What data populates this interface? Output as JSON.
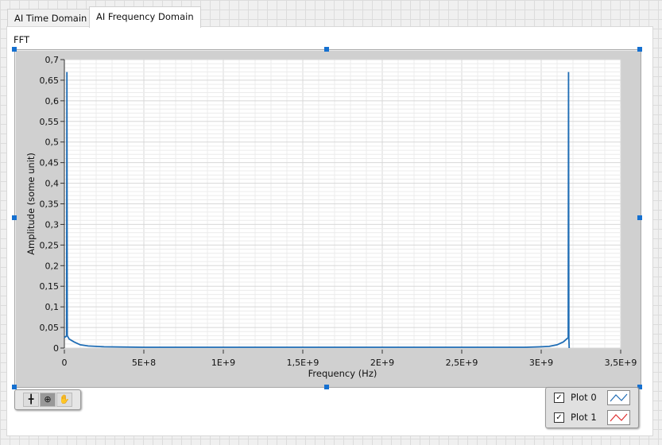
{
  "tabs": [
    {
      "label": "AI Time Domain"
    },
    {
      "label": "AI Frequency Domain"
    }
  ],
  "graph": {
    "label": "FFT"
  },
  "chart_data": {
    "type": "line",
    "xlabel": "Frequency (Hz)",
    "ylabel": "Amplitude (some unit)",
    "xlim": [
      0,
      3500000000
    ],
    "ylim": [
      0,
      0.7
    ],
    "x_ticks": [
      0,
      500000000,
      1000000000,
      1500000000,
      2000000000,
      2500000000,
      3000000000,
      3500000000
    ],
    "x_tick_labels": [
      "0",
      "5E+8",
      "1E+9",
      "1,5E+9",
      "2E+9",
      "2,5E+9",
      "3E+9",
      "3,5E+9"
    ],
    "y_ticks": [
      0,
      0.05,
      0.1,
      0.15,
      0.2,
      0.25,
      0.3,
      0.35,
      0.4,
      0.45,
      0.5,
      0.55,
      0.6,
      0.65,
      0.7
    ],
    "y_tick_labels": [
      "0",
      "0,05",
      "0,1",
      "0,15",
      "0,2",
      "0,25",
      "0,3",
      "0,35",
      "0,4",
      "0,45",
      "0,5",
      "0,55",
      "0,6",
      "0,65",
      "0,7"
    ],
    "grid": true,
    "series": [
      {
        "name": "Plot 0",
        "color": "#1f6db5",
        "x": [
          0,
          5000000,
          10000000,
          14000000,
          16000000,
          18000000,
          30000000,
          60000000,
          100000000,
          150000000,
          200000000,
          250000000,
          500000000,
          1000000000,
          1500000000,
          2000000000,
          2500000000,
          2900000000,
          3000000000,
          3050000000,
          3100000000,
          3140000000,
          3160000000,
          3170000000,
          3172000000,
          3174000000,
          3176000000
        ],
        "y": [
          0.025,
          0.027,
          0.028,
          0.03,
          0.67,
          0.03,
          0.022,
          0.015,
          0.008,
          0.005,
          0.004,
          0.003,
          0.002,
          0.002,
          0.002,
          0.002,
          0.002,
          0.002,
          0.003,
          0.004,
          0.008,
          0.015,
          0.022,
          0.025,
          0.67,
          0.025,
          0.0
        ]
      }
    ]
  },
  "legend": {
    "items": [
      {
        "label": "Plot 0",
        "checked": true,
        "color": "#1f6db5"
      },
      {
        "label": "Plot 1",
        "checked": true,
        "color": "#e03030"
      }
    ]
  },
  "palette": {
    "tools": [
      "cursor-move",
      "zoom",
      "pan"
    ]
  }
}
